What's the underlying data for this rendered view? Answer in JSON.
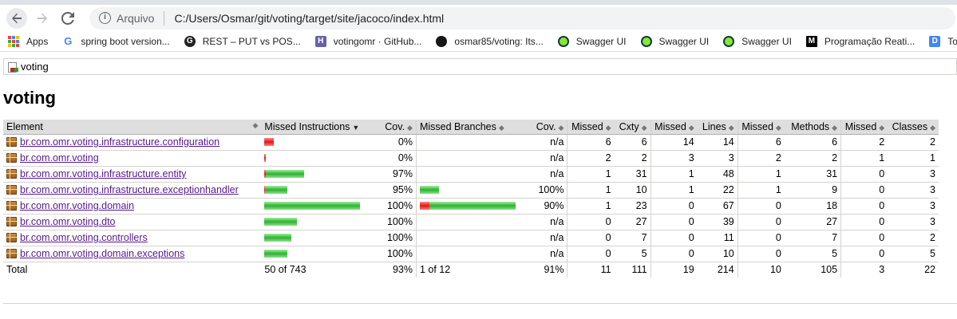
{
  "browser": {
    "origin_label": "Arquivo",
    "url": "C:/Users/Osmar/git/voting/target/site/jacoco/index.html"
  },
  "bookmarks": [
    {
      "label": "Apps",
      "icon": "apps-grid-icon"
    },
    {
      "label": "spring boot version...",
      "icon": "google-icon"
    },
    {
      "label": "REST – PUT vs POS...",
      "icon": "site-g-icon"
    },
    {
      "label": "votingomr · GitHub...",
      "icon": "heroku-icon"
    },
    {
      "label": "osmar85/voting: Its...",
      "icon": "github-icon"
    },
    {
      "label": "Swagger UI",
      "icon": "swagger-icon"
    },
    {
      "label": "Swagger UI",
      "icon": "swagger-icon"
    },
    {
      "label": "Swagger UI",
      "icon": "swagger-icon"
    },
    {
      "label": "Programação Reati...",
      "icon": "medium-icon"
    },
    {
      "label": "Toker",
      "icon": "docs-icon"
    }
  ],
  "breadcrumb": {
    "label": "voting"
  },
  "page_title": "voting",
  "colors": {
    "missed_bar": "#e01818",
    "covered_bar": "#2fb12f",
    "header_bg": "#dedede"
  },
  "table": {
    "headers": [
      "Element",
      "Missed Instructions",
      "Cov.",
      "Missed Branches",
      "Cov.",
      "Missed",
      "Cxty",
      "Missed",
      "Lines",
      "Missed",
      "Methods",
      "Missed",
      "Classes"
    ],
    "rows": [
      {
        "name": "br.com.omr.voting.infrastructure.configuration",
        "instr_missed_frac": 1.0,
        "instr_total": 0.1,
        "instr_cov": "0%",
        "br_missed_frac": null,
        "br_total": 0,
        "br_cov": "n/a",
        "cxty_missed": "6",
        "cxty": "6",
        "lines_missed": "14",
        "lines": "14",
        "methods_missed": "6",
        "methods": "6",
        "classes_missed": "2",
        "classes": "2"
      },
      {
        "name": "br.com.omr.voting",
        "instr_missed_frac": 1.0,
        "instr_total": 0.02,
        "instr_cov": "0%",
        "br_missed_frac": null,
        "br_total": 0,
        "br_cov": "n/a",
        "cxty_missed": "2",
        "cxty": "2",
        "lines_missed": "3",
        "lines": "3",
        "methods_missed": "2",
        "methods": "2",
        "classes_missed": "1",
        "classes": "1"
      },
      {
        "name": "br.com.omr.voting.infrastructure.entity",
        "instr_missed_frac": 0.03,
        "instr_total": 0.42,
        "instr_cov": "97%",
        "br_missed_frac": null,
        "br_total": 0,
        "br_cov": "n/a",
        "cxty_missed": "1",
        "cxty": "31",
        "lines_missed": "1",
        "lines": "48",
        "methods_missed": "1",
        "methods": "31",
        "classes_missed": "0",
        "classes": "3"
      },
      {
        "name": "br.com.omr.voting.infrastructure.exceptionhandler",
        "instr_missed_frac": 0.05,
        "instr_total": 0.24,
        "instr_cov": "95%",
        "br_missed_frac": 0.0,
        "br_total": 0.2,
        "br_cov": "100%",
        "cxty_missed": "1",
        "cxty": "10",
        "lines_missed": "1",
        "lines": "22",
        "methods_missed": "1",
        "methods": "9",
        "classes_missed": "0",
        "classes": "3"
      },
      {
        "name": "br.com.omr.voting.domain",
        "instr_missed_frac": 0.0,
        "instr_total": 1.0,
        "instr_cov": "100%",
        "br_missed_frac": 0.1,
        "br_total": 1.0,
        "br_cov": "90%",
        "cxty_missed": "1",
        "cxty": "23",
        "lines_missed": "0",
        "lines": "67",
        "methods_missed": "0",
        "methods": "18",
        "classes_missed": "0",
        "classes": "3"
      },
      {
        "name": "br.com.omr.voting.dto",
        "instr_missed_frac": 0.0,
        "instr_total": 0.34,
        "instr_cov": "100%",
        "br_missed_frac": null,
        "br_total": 0,
        "br_cov": "n/a",
        "cxty_missed": "0",
        "cxty": "27",
        "lines_missed": "0",
        "lines": "39",
        "methods_missed": "0",
        "methods": "27",
        "classes_missed": "0",
        "classes": "3"
      },
      {
        "name": "br.com.omr.voting.controllers",
        "instr_missed_frac": 0.0,
        "instr_total": 0.28,
        "instr_cov": "100%",
        "br_missed_frac": null,
        "br_total": 0,
        "br_cov": "n/a",
        "cxty_missed": "0",
        "cxty": "7",
        "lines_missed": "0",
        "lines": "11",
        "methods_missed": "0",
        "methods": "7",
        "classes_missed": "0",
        "classes": "2"
      },
      {
        "name": "br.com.omr.voting.domain.exceptions",
        "instr_missed_frac": 0.0,
        "instr_total": 0.24,
        "instr_cov": "100%",
        "br_missed_frac": null,
        "br_total": 0,
        "br_cov": "n/a",
        "cxty_missed": "0",
        "cxty": "5",
        "lines_missed": "0",
        "lines": "10",
        "methods_missed": "0",
        "methods": "5",
        "classes_missed": "0",
        "classes": "5"
      }
    ],
    "total": {
      "label": "Total",
      "instr": "50 of 743",
      "instr_cov": "93%",
      "br": "1 of 12",
      "br_cov": "91%",
      "cxty_missed": "11",
      "cxty": "111",
      "lines_missed": "19",
      "lines": "214",
      "methods_missed": "10",
      "methods": "105",
      "classes_missed": "3",
      "classes": "22"
    }
  }
}
